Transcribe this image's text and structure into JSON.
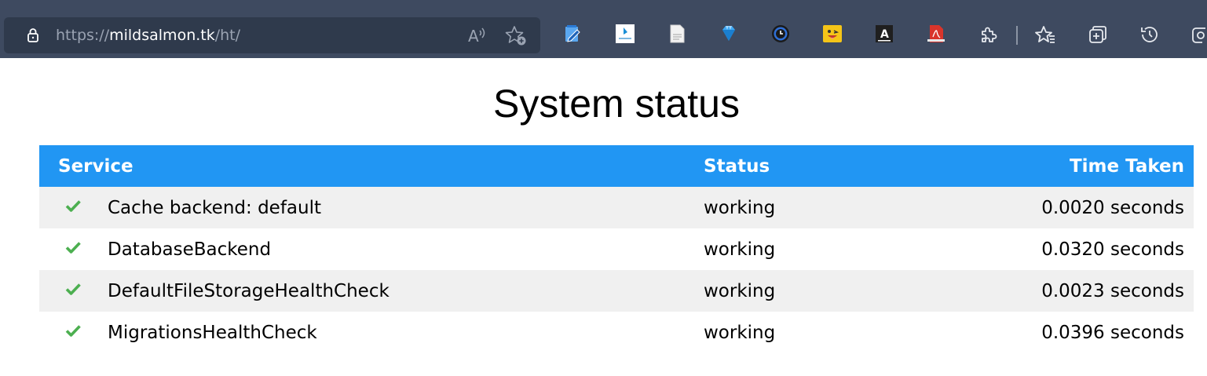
{
  "browser": {
    "url_scheme": "https://",
    "url_host": "mildsalmon.tk",
    "url_path": "/ht/"
  },
  "toolbar_icons": [
    "notepad-extension-icon",
    "mapping-extension-icon",
    "document-extension-icon",
    "gem-extension-icon",
    "clock-extension-icon",
    "emoji-extension-icon",
    "dark-a-extension-icon",
    "pdf-extension-icon",
    "extensions-puzzle-icon",
    "favorites-icon",
    "collections-icon",
    "history-icon",
    "screenshot-icon"
  ],
  "page": {
    "title": "System status"
  },
  "table": {
    "headers": {
      "service": "Service",
      "status": "Status",
      "time": "Time Taken"
    },
    "rows": [
      {
        "service": "Cache backend: default",
        "status": "working",
        "time": "0.0020 seconds"
      },
      {
        "service": "DatabaseBackend",
        "status": "working",
        "time": "0.0320 seconds"
      },
      {
        "service": "DefaultFileStorageHealthCheck",
        "status": "working",
        "time": "0.0023 seconds"
      },
      {
        "service": "MigrationsHealthCheck",
        "status": "working",
        "time": "0.0396 seconds"
      }
    ]
  },
  "colors": {
    "toolbar_bg": "#3e4a60",
    "address_bg": "#2f3a4c",
    "header_bg": "#2196f3",
    "check_green": "#4caf50",
    "row_alt_bg": "#f0f0f0"
  }
}
